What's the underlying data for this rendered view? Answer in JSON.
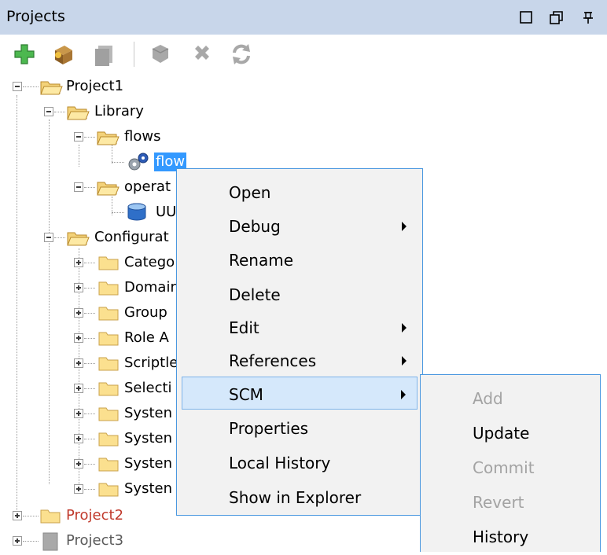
{
  "panel": {
    "title": "Projects"
  },
  "window_buttons": [
    "maximize-icon",
    "restore-icon",
    "pin-icon"
  ],
  "toolbar": {
    "buttons": [
      {
        "name": "add-icon",
        "color": "#2e9e33"
      },
      {
        "name": "import-icon",
        "color": "#9a6b2a"
      },
      {
        "name": "copy-icon",
        "color": "#a0a0a0"
      },
      {
        "name": "scm-icon",
        "color": "#a0a0a0"
      },
      {
        "name": "delete-icon",
        "color": "#a0a0a0"
      },
      {
        "name": "refresh-icon",
        "color": "#a0a0a0"
      }
    ]
  },
  "tree": {
    "project1": "Project1",
    "library": "Library",
    "flows": "flows",
    "flow": "flow",
    "operations": "operat",
    "uu": "UU",
    "configuration": "Configurat",
    "categories": "Catego",
    "domain": "Domair",
    "group": "Group",
    "role": "Role A",
    "scriptlets": "Scriptle",
    "selection": "Selecti",
    "system1": "Systen",
    "system2": "Systen",
    "system3": "Systen",
    "system4": "Systen",
    "project2": "Project2",
    "project3": "Project3",
    "project2_color": "#c0392b",
    "project3_color": "#5a5a5a"
  },
  "context_menu": {
    "items": [
      {
        "label": "Open",
        "submenu": false
      },
      {
        "label": "Debug",
        "submenu": true
      },
      {
        "label": "Rename",
        "submenu": false
      },
      {
        "label": "Delete",
        "submenu": false
      },
      {
        "label": "Edit",
        "submenu": true
      },
      {
        "label": "References",
        "submenu": true
      },
      {
        "label": "SCM",
        "submenu": true,
        "highlighted": true
      },
      {
        "label": "Properties",
        "submenu": false
      },
      {
        "label": "Local History",
        "submenu": false
      },
      {
        "label": "Show in Explorer",
        "submenu": false
      }
    ]
  },
  "scm_submenu": {
    "items": [
      {
        "label": "Add",
        "enabled": false
      },
      {
        "label": "Update",
        "enabled": true
      },
      {
        "label": "Commit",
        "enabled": false
      },
      {
        "label": "Revert",
        "enabled": false
      },
      {
        "label": "History",
        "enabled": true
      }
    ]
  },
  "colors": {
    "accent": "#3399ff",
    "titlebar": "#c8d6ea",
    "menu_border": "#4a98e0"
  }
}
